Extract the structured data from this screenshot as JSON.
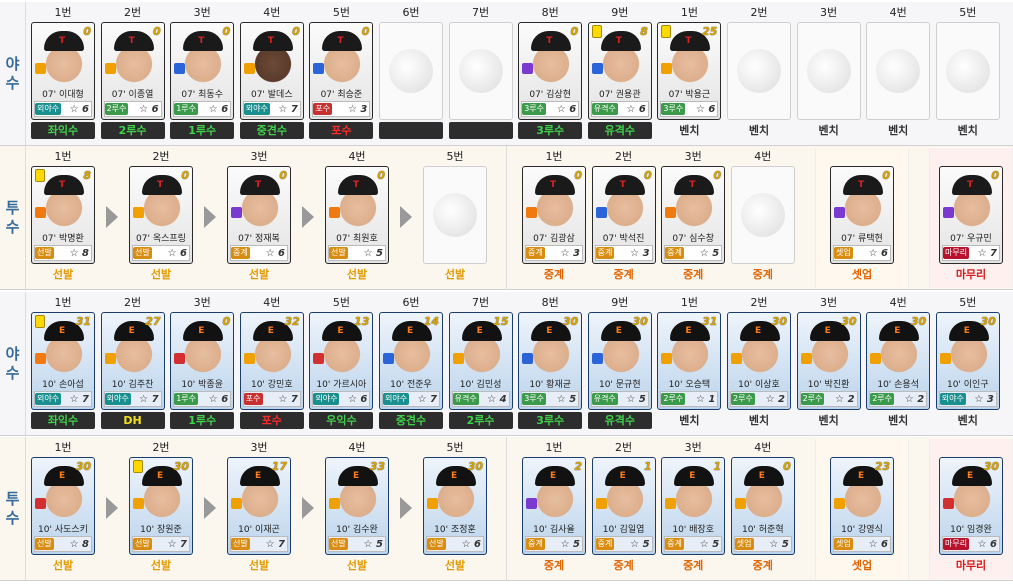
{
  "sections": [
    {
      "side": [
        "야",
        "수"
      ],
      "kind": "fielders",
      "team": "lg",
      "cards": [
        {
          "pos": "1번",
          "name": "07' 이대형",
          "num": "0",
          "badge": "외야수",
          "star": "6",
          "role": "좌익수",
          "roleStyle": "dk",
          "ico": "y"
        },
        {
          "pos": "2번",
          "name": "07' 이종열",
          "num": "0",
          "badge": "2루수",
          "star": "6",
          "role": "2루수",
          "roleStyle": "dk",
          "ico": "y"
        },
        {
          "pos": "3번",
          "name": "07' 최동수",
          "num": "0",
          "badge": "1루수",
          "star": "6",
          "role": "1루수",
          "roleStyle": "dk",
          "ico": "b"
        },
        {
          "pos": "4번",
          "name": "07' 발데스",
          "num": "0",
          "badge": "외야수",
          "star": "7",
          "role": "중견수",
          "roleStyle": "dk",
          "ico": "y",
          "dark": true
        },
        {
          "pos": "5번",
          "name": "07' 최승준",
          "num": "0",
          "badge": "포수",
          "star": "3",
          "role": "포수",
          "roleStyle": "red",
          "ico": "b"
        },
        {
          "pos": "6번",
          "empty": true,
          "role": "",
          "roleStyle": "blank"
        },
        {
          "pos": "7번",
          "empty": true,
          "role": "",
          "roleStyle": "blank"
        },
        {
          "pos": "8번",
          "name": "07' 김상현",
          "num": "0",
          "badge": "3루수",
          "star": "6",
          "role": "3루수",
          "roleStyle": "dk",
          "ico": "p"
        },
        {
          "pos": "9번",
          "name": "07' 권용관",
          "num": "8",
          "badge": "유격수",
          "star": "6",
          "role": "유격수",
          "roleStyle": "dk",
          "ico": "b",
          "tag": true
        },
        {
          "pos": "1번",
          "name": "07' 박용근",
          "num": "25",
          "badge": "3루수",
          "star": "6",
          "role": "벤치",
          "roleStyle": "bench",
          "ico": "y",
          "tag": true
        },
        {
          "pos": "2번",
          "empty": true,
          "role": "벤치",
          "roleStyle": "bench"
        },
        {
          "pos": "3번",
          "empty": true,
          "role": "벤치",
          "roleStyle": "bench"
        },
        {
          "pos": "4번",
          "empty": true,
          "role": "벤치",
          "roleStyle": "bench"
        },
        {
          "pos": "5번",
          "empty": true,
          "role": "벤치",
          "roleStyle": "bench"
        }
      ]
    },
    {
      "side": [
        "투",
        "수"
      ],
      "kind": "pitchers",
      "team": "lg",
      "starters": [
        {
          "pos": "1번",
          "name": "07' 박명환",
          "num": "8",
          "badge": "선발",
          "star": "8",
          "role": "선발",
          "ico": "o",
          "tag": true
        },
        {
          "pos": "2번",
          "name": "07' 옥스프링",
          "num": "0",
          "badge": "선발",
          "star": "6",
          "role": "선발",
          "ico": "y"
        },
        {
          "pos": "3번",
          "name": "07' 정재복",
          "num": "0",
          "badge": "중계",
          "star": "6",
          "role": "선발",
          "ico": "p"
        },
        {
          "pos": "4번",
          "name": "07' 최원호",
          "num": "0",
          "badge": "선발",
          "star": "5",
          "role": "선발",
          "ico": "o"
        },
        {
          "pos": "5번",
          "empty": true,
          "role": "선발"
        }
      ],
      "relief": [
        {
          "pos": "1번",
          "name": "07' 김광삼",
          "num": "0",
          "badge": "중계",
          "star": "3",
          "role": "중계",
          "ico": "o"
        },
        {
          "pos": "2번",
          "name": "07' 박석진",
          "num": "0",
          "badge": "중계",
          "star": "3",
          "role": "중계",
          "ico": "b"
        },
        {
          "pos": "3번",
          "name": "07' 심수창",
          "num": "0",
          "badge": "중계",
          "star": "5",
          "role": "중계",
          "ico": "o"
        },
        {
          "pos": "4번",
          "empty": true,
          "role": "중계"
        }
      ],
      "setup": {
        "name": "07' 류택현",
        "num": "0",
        "badge": "셋업",
        "star": "6",
        "role": "셋업",
        "ico": "p"
      },
      "closer": {
        "name": "07' 우규민",
        "num": "0",
        "badge": "마무리",
        "star": "7",
        "role": "마무리",
        "ico": "p"
      }
    },
    {
      "side": [
        "야",
        "수"
      ],
      "kind": "fielders",
      "team": "hanwha",
      "cards": [
        {
          "pos": "1번",
          "name": "10' 손아섭",
          "num": "31",
          "badge": "외야수",
          "star": "7",
          "role": "좌익수",
          "roleStyle": "dk",
          "ico": "o",
          "tag": true
        },
        {
          "pos": "2번",
          "name": "10' 김주찬",
          "num": "27",
          "badge": "외야수",
          "star": "7",
          "role": "DH",
          "roleStyle": "dh",
          "ico": "y"
        },
        {
          "pos": "3번",
          "name": "10' 박종윤",
          "num": "0",
          "badge": "1루수",
          "star": "6",
          "role": "1루수",
          "roleStyle": "dk",
          "ico": "r"
        },
        {
          "pos": "4번",
          "name": "10' 강민호",
          "num": "32",
          "badge": "포수",
          "star": "7",
          "role": "포수",
          "roleStyle": "red",
          "ico": "y"
        },
        {
          "pos": "5번",
          "name": "10' 가르시아",
          "num": "13",
          "badge": "외야수",
          "star": "6",
          "role": "우익수",
          "roleStyle": "dk",
          "ico": "r"
        },
        {
          "pos": "6번",
          "name": "10' 전준우",
          "num": "14",
          "badge": "외야수",
          "star": "7",
          "role": "중견수",
          "roleStyle": "dk",
          "ico": "b"
        },
        {
          "pos": "7번",
          "name": "10' 김민성",
          "num": "15",
          "badge": "유격수",
          "star": "4",
          "role": "2루수",
          "roleStyle": "dk",
          "ico": "y"
        },
        {
          "pos": "8번",
          "name": "10' 황재균",
          "num": "30",
          "badge": "3루수",
          "star": "5",
          "role": "3루수",
          "roleStyle": "dk",
          "ico": "b"
        },
        {
          "pos": "9번",
          "name": "10' 문규현",
          "num": "30",
          "badge": "유격수",
          "star": "5",
          "role": "유격수",
          "roleStyle": "dk",
          "ico": "b"
        },
        {
          "pos": "1번",
          "name": "10' 오승택",
          "num": "31",
          "badge": "2루수",
          "star": "1",
          "role": "벤치",
          "roleStyle": "bench",
          "ico": "y"
        },
        {
          "pos": "2번",
          "name": "10' 이상호",
          "num": "30",
          "badge": "2루수",
          "star": "2",
          "role": "벤치",
          "roleStyle": "bench",
          "ico": "y"
        },
        {
          "pos": "3번",
          "name": "10' 박진환",
          "num": "30",
          "badge": "2루수",
          "star": "2",
          "role": "벤치",
          "roleStyle": "bench",
          "ico": "y"
        },
        {
          "pos": "4번",
          "name": "10' 손용석",
          "num": "30",
          "badge": "2루수",
          "star": "2",
          "role": "벤치",
          "roleStyle": "bench",
          "ico": "y"
        },
        {
          "pos": "5번",
          "name": "10' 이인구",
          "num": "30",
          "badge": "외야수",
          "star": "3",
          "role": "벤치",
          "roleStyle": "bench",
          "ico": "y"
        }
      ]
    },
    {
      "side": [
        "투",
        "수"
      ],
      "kind": "pitchers",
      "team": "hanwha",
      "starters": [
        {
          "pos": "1번",
          "name": "10' 사도스키",
          "num": "30",
          "badge": "선발",
          "star": "8",
          "role": "선발",
          "ico": "r"
        },
        {
          "pos": "2번",
          "name": "10' 장원준",
          "num": "30",
          "badge": "선발",
          "star": "7",
          "role": "선발",
          "ico": "y",
          "tag": true
        },
        {
          "pos": "3번",
          "name": "10' 이재곤",
          "num": "17",
          "badge": "선발",
          "star": "7",
          "role": "선발",
          "ico": "y"
        },
        {
          "pos": "4번",
          "name": "10' 김수완",
          "num": "33",
          "badge": "선발",
          "star": "5",
          "role": "선발",
          "ico": "y"
        },
        {
          "pos": "5번",
          "name": "10' 조정훈",
          "num": "30",
          "badge": "선발",
          "star": "6",
          "role": "선발",
          "ico": "y"
        }
      ],
      "relief": [
        {
          "pos": "1번",
          "name": "10' 김사율",
          "num": "2",
          "badge": "중계",
          "star": "5",
          "role": "중계",
          "ico": "p"
        },
        {
          "pos": "2번",
          "name": "10' 김일엽",
          "num": "1",
          "badge": "중계",
          "star": "5",
          "role": "중계",
          "ico": "y"
        },
        {
          "pos": "3번",
          "name": "10' 배장호",
          "num": "1",
          "badge": "중계",
          "star": "5",
          "role": "중계",
          "ico": "y"
        },
        {
          "pos": "4번",
          "name": "10' 허준혁",
          "num": "0",
          "badge": "셋업",
          "star": "5",
          "role": "중계",
          "ico": "y"
        }
      ],
      "setup": {
        "name": "10' 강영식",
        "num": "23",
        "badge": "셋업",
        "star": "6",
        "role": "셋업",
        "ico": "y"
      },
      "closer": {
        "name": "10' 임경완",
        "num": "30",
        "badge": "마무리",
        "star": "6",
        "role": "마무리",
        "ico": "r"
      }
    }
  ],
  "colors": {
    "fieldLabelGreen": "#3ed24a",
    "catcherRed": "#ff2a2a",
    "starter": "#e39a00",
    "relief": "#e06400",
    "closer": "#d41a1a"
  }
}
